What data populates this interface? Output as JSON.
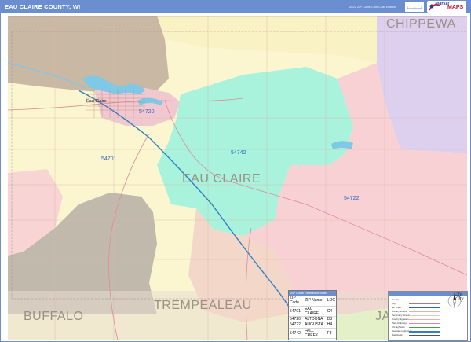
{
  "header": {
    "title": "EAU CLAIRE COUNTY, WI",
    "edition": "2022 ZIP Code ColorCast Edition",
    "brand_text_1": "Market",
    "brand_text_2": "MAPS",
    "brand_logo": "market-maps-logo"
  },
  "map": {
    "county_labels": {
      "chippewa": "CHIPPEWA",
      "eau_claire": "EAU CLAIRE",
      "buffalo": "BUFFALO",
      "trempealeau": "TREMPEALEAU",
      "jackson": "JACKSO"
    },
    "zip_labels": {
      "z54720": "54720",
      "z54701": "54701",
      "z54742": "54742",
      "z54722": "54722"
    },
    "city_labels": {
      "eau_claire": "Eau Claire"
    },
    "colors": {
      "tan": "#c9b8a4",
      "yellow": "#fbf6cf",
      "mint": "#a9f2dc",
      "pink": "#f8d1d4",
      "lavender": "#dcd0ee",
      "gray_brown": "#c2b9ad",
      "light_green": "#e4f0c8",
      "water": "#7fc8e6",
      "road": "#e08a9a",
      "highway": "#2f80c6"
    }
  },
  "zip_table": {
    "header": "ZIP Code Reference Index",
    "columns": [
      "ZIP Code",
      "ZIP Name",
      "LOC"
    ],
    "rows": [
      [
        "54701",
        "EAU CLAIRE",
        "C4"
      ],
      [
        "54720",
        "ALTOONA",
        "D3"
      ],
      [
        "54722",
        "AUGUSTA",
        "H4"
      ],
      [
        "54742",
        "FALL CREEK",
        "F3"
      ]
    ]
  },
  "legend": {
    "rows": [
      "County",
      "City",
      "ZIP Code",
      "Primary Streets",
      "Secondary Streets",
      "County Highways",
      "State Highways",
      "US Highways",
      "Interstate Highways",
      "Rail Roads"
    ],
    "compass_labels": [
      "City",
      "City"
    ]
  }
}
